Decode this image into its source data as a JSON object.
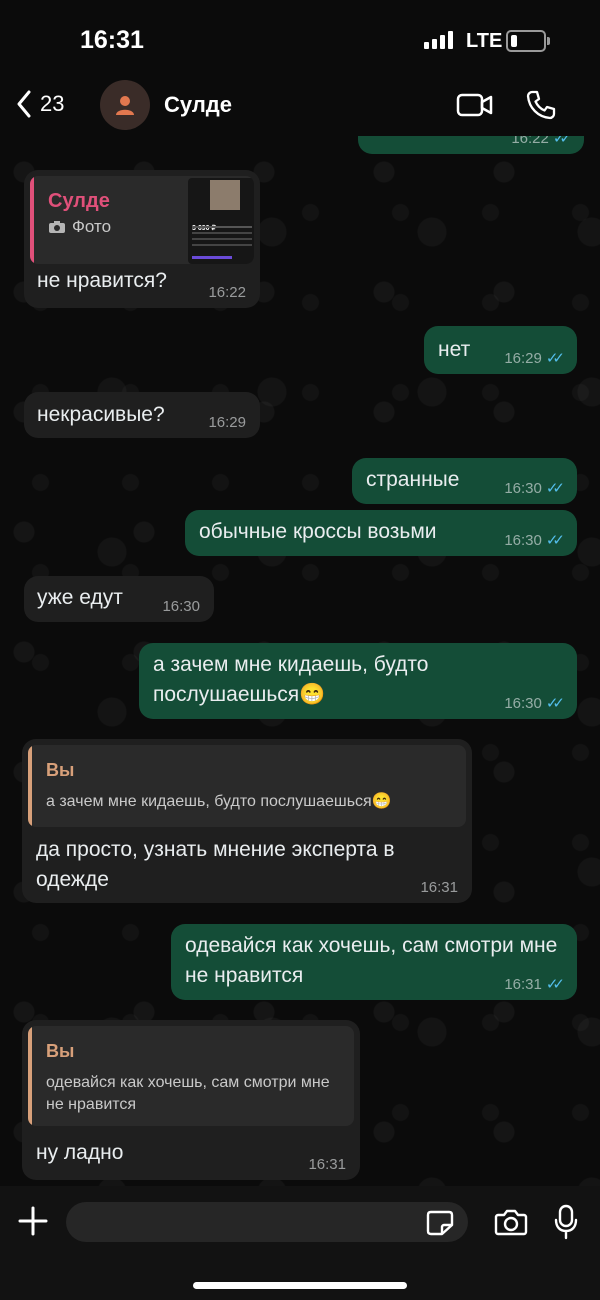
{
  "status": {
    "time": "16:31",
    "network": "LTE"
  },
  "header": {
    "back_count": "23",
    "contact_name": "Сулде"
  },
  "messages": [
    {
      "dir": "out",
      "text": "",
      "time": "16:22"
    },
    {
      "dir": "in",
      "quote_author": "Сулде",
      "quote_text": "Фото",
      "photo_price": "3 690 ₽",
      "text": "не нравится?",
      "time": "16:22"
    },
    {
      "dir": "out",
      "text": "нет",
      "time": "16:29"
    },
    {
      "dir": "in",
      "text": "некрасивые?",
      "time": "16:29"
    },
    {
      "dir": "out",
      "text": "странные",
      "time": "16:30"
    },
    {
      "dir": "out",
      "text": "обычные кроссы возьми",
      "time": "16:30"
    },
    {
      "dir": "in",
      "text": "уже едут",
      "time": "16:30"
    },
    {
      "dir": "out",
      "text": "а зачем мне кидаешь, будто послушаешься😁",
      "time": "16:30"
    },
    {
      "dir": "in",
      "quote_author": "Вы",
      "quote_text": "а зачем мне кидаешь, будто послушаешься😁",
      "text": "да просто, узнать мнение эксперта в одежде",
      "time": "16:31"
    },
    {
      "dir": "out",
      "text": "одевайся как хочешь, сам смотри мне не нравится",
      "time": "16:31"
    },
    {
      "dir": "in",
      "quote_author": "Вы",
      "quote_text": "одевайся как хочешь, сам смотри мне не нравится",
      "text": "ну ладно",
      "time": "16:31"
    }
  ],
  "input": {
    "placeholder": ""
  },
  "colors": {
    "incoming": "#1f1f1f",
    "outgoing": "#144d37",
    "quote_sulde": "#e0507a",
    "quote_you": "#d8a07a",
    "read_ticks": "#53bdeb"
  },
  "icons": [
    "back-chevron-icon",
    "person-icon",
    "video-camera-icon",
    "phone-icon",
    "plus-icon",
    "sticker-icon",
    "camera-icon",
    "microphone-icon"
  ]
}
